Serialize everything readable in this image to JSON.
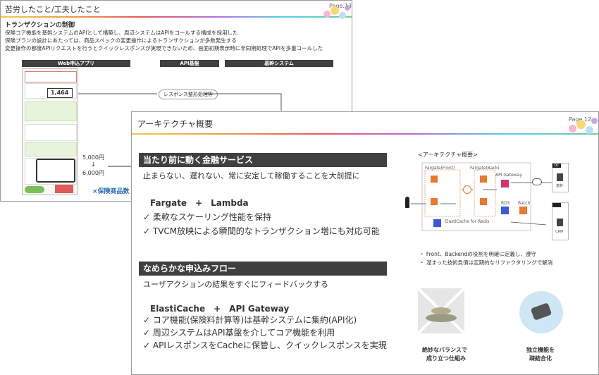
{
  "back_slide": {
    "title": "苦労したこと/工夫したこと",
    "page": "Page.13",
    "subtitle": "トランザクションの制御",
    "lines": [
      "保険コア機能を基幹システムのAPIとして構築し、周辺システムはAPIをコールする構成を採用した",
      "保険プランの設計にあたっては、商品スペックの変更操作によるトランザクションが多数発生する",
      "変更操作の都度APIリクエストを行うとクイックレスポンスが実現できないため、画面初期表示時に非同期処理でAPIを多重コールした"
    ],
    "columns": [
      "Web申込アプリ",
      "API基盤",
      "基幹システム"
    ],
    "response_label": "レスポンス整形処理等",
    "amount": "1,464",
    "range_from": "5,000円",
    "arrow": "↓",
    "range_to": "6,000円",
    "caption": "×保険商品数"
  },
  "front_slide": {
    "title": "アーキテクチャ概要",
    "page": "Page.12",
    "section1": {
      "heading": "当たり前に動く金融サービス",
      "lead": "止まらない、遅れない、常に安定して稼働することを大前提に",
      "tech": "Fargate　+　Lambda",
      "bullets": [
        "柔軟なスケーリング性能を保持",
        "TVCM放映による瞬間的なトランザクション増にも対応可能"
      ]
    },
    "section2": {
      "heading": "なめらかな申込みフロー",
      "lead": "ユーザアクションの結果をすぐにフィードバックする",
      "tech": "ElastiCache　+　API Gateway",
      "bullets": [
        "コア機能(保険料計算等)は基幹システムに集約(API化)",
        "周辺システムはAPI基盤を介してコア機能を利用",
        "APIレスポンスをCacheに保管し、クイックレスポンスを実現"
      ]
    },
    "diagram": {
      "title": "<アーキテクチャ概要>",
      "fargate_front": "Fargate(Front)",
      "fargate_back": "Fargate(Back)",
      "api_gateway": "API Gateway",
      "rds": "RDS",
      "batch": "Batch",
      "elasticache": "ElastiCache for Redis",
      "dc": "DC",
      "kikan": "基幹",
      "crm": "CRM",
      "notes": [
        "Front、Backendの役割を明確に定義し、遵守",
        "溜まった技術負債は定期的なリファクタリングで解消"
      ]
    },
    "image1_caption": [
      "絶妙なバランスで",
      "成り立つ仕組み"
    ],
    "image2_caption": [
      "独立機能を",
      "疎結合化"
    ]
  },
  "colors": {
    "section_bar": "#404040",
    "aws_orange": "#e8792d",
    "aws_purple": "#8c4fff",
    "aws_pink": "#d6336c"
  }
}
